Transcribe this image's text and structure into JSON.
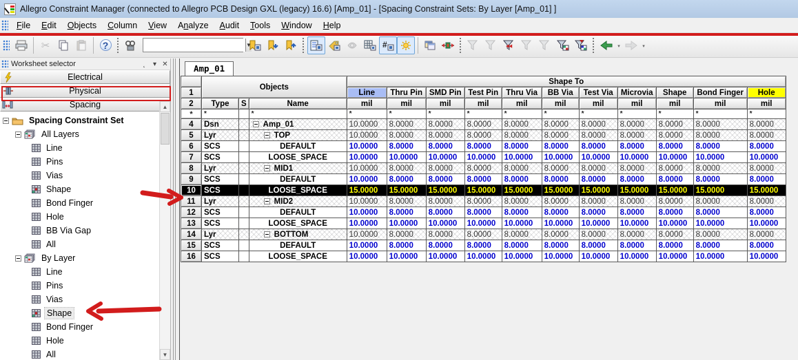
{
  "window": {
    "title": "Allegro Constraint Manager (connected to Allegro PCB Design GXL (legacy) 16.6) [Amp_01] - [Spacing Constraint Sets:  By Layer [Amp_01] ]"
  },
  "menu": {
    "items": [
      {
        "label": "File",
        "underline": 0
      },
      {
        "label": "Edit",
        "underline": 0
      },
      {
        "label": "Objects",
        "underline": 0
      },
      {
        "label": "Column",
        "underline": 0
      },
      {
        "label": "View",
        "underline": 0
      },
      {
        "label": "Analyze",
        "underline": 1
      },
      {
        "label": "Audit",
        "underline": 0
      },
      {
        "label": "Tools",
        "underline": 0
      },
      {
        "label": "Window",
        "underline": 0
      },
      {
        "label": "Help",
        "underline": 0
      }
    ]
  },
  "toolbar": {
    "search": {
      "value": "",
      "placeholder": ""
    },
    "buttons": [
      {
        "name": "print-icon",
        "disabled": false,
        "active": false
      },
      {
        "name": "cut-icon",
        "disabled": true,
        "active": false
      },
      {
        "name": "copy-icon",
        "disabled": false,
        "active": false
      },
      {
        "name": "paste-icon",
        "disabled": true,
        "active": false
      },
      {
        "name": "help-icon",
        "disabled": false,
        "active": false
      },
      {
        "name": "find-icon",
        "disabled": false,
        "active": false
      },
      {
        "name": "bookmark-add-icon",
        "disabled": false,
        "active": false
      },
      {
        "name": "bookmark-down-icon",
        "disabled": false,
        "active": false
      },
      {
        "name": "bookmark-up-icon",
        "disabled": false,
        "active": false
      },
      {
        "name": "worksheet-selector-icon",
        "disabled": false,
        "active": true
      },
      {
        "name": "tag-icon",
        "disabled": false,
        "active": false
      },
      {
        "name": "hierarchy-icon",
        "disabled": true,
        "active": false
      },
      {
        "name": "table-view-icon",
        "disabled": false,
        "active": false
      },
      {
        "name": "show-values-icon",
        "disabled": false,
        "active": true
      },
      {
        "name": "highlight-icon",
        "disabled": false,
        "active": true
      },
      {
        "name": "copy-window-icon",
        "disabled": false,
        "active": false
      },
      {
        "name": "cross-probe-icon",
        "disabled": false,
        "active": false
      },
      {
        "name": "filter-refresh-icon",
        "disabled": true,
        "active": false
      },
      {
        "name": "filter-off-icon",
        "disabled": true,
        "active": false
      },
      {
        "name": "filter-bowtie-icon",
        "disabled": false,
        "active": false
      },
      {
        "name": "filter-sort-icon",
        "disabled": true,
        "active": false
      },
      {
        "name": "filter-hatch-icon",
        "disabled": true,
        "active": false
      },
      {
        "name": "filter-table-icon",
        "disabled": false,
        "active": false
      },
      {
        "name": "filter-color-icon",
        "disabled": false,
        "active": false
      },
      {
        "name": "back-icon",
        "disabled": false,
        "active": false
      },
      {
        "name": "forward-icon",
        "disabled": true,
        "active": false
      }
    ]
  },
  "sidebar": {
    "header": {
      "title": "Worksheet selector"
    },
    "selectors": [
      {
        "label": "Electrical",
        "icon": "lightning-icon",
        "annotated": false
      },
      {
        "label": "Physical",
        "icon": "physical-icon",
        "annotated": false
      },
      {
        "label": "Spacing",
        "icon": "spacing-icon",
        "annotated": true
      }
    ],
    "tree": {
      "root": {
        "label": "Spacing Constraint Set",
        "icon": "folder-icon"
      },
      "groups": [
        {
          "label": "All Layers",
          "icon": "layers-icon",
          "items": [
            {
              "label": "Line",
              "icon": "grid-icon",
              "selected": false
            },
            {
              "label": "Pins",
              "icon": "grid-icon",
              "selected": false
            },
            {
              "label": "Vias",
              "icon": "grid-icon",
              "selected": false
            },
            {
              "label": "Shape",
              "icon": "grid-red-icon",
              "selected": false
            },
            {
              "label": "Bond Finger",
              "icon": "grid-icon",
              "selected": false
            },
            {
              "label": "Hole",
              "icon": "grid-icon",
              "selected": false
            },
            {
              "label": "BB Via Gap",
              "icon": "grid-icon",
              "selected": false
            },
            {
              "label": "All",
              "icon": "grid-icon",
              "selected": false
            }
          ]
        },
        {
          "label": "By Layer",
          "icon": "layers-icon",
          "items": [
            {
              "label": "Line",
              "icon": "grid-icon",
              "selected": false
            },
            {
              "label": "Pins",
              "icon": "grid-icon",
              "selected": false
            },
            {
              "label": "Vias",
              "icon": "grid-icon",
              "selected": false
            },
            {
              "label": "Shape",
              "icon": "grid-red-icon",
              "selected": true
            },
            {
              "label": "Bond Finger",
              "icon": "grid-icon",
              "selected": false
            },
            {
              "label": "Hole",
              "icon": "grid-icon",
              "selected": false
            },
            {
              "label": "All",
              "icon": "grid-icon",
              "selected": false
            }
          ]
        }
      ]
    }
  },
  "main": {
    "tab": "Amp_01",
    "table": {
      "objects_header": "Objects",
      "shape_to_header": "Shape To",
      "row1_label": "1",
      "row2_label": "2",
      "filter_label": "*",
      "type_header": "Type",
      "s_header": "S",
      "name_header": "Name",
      "unit": "mil",
      "columns": [
        {
          "label": "Line",
          "highlight": "blue"
        },
        {
          "label": "Thru Pin",
          "highlight": ""
        },
        {
          "label": "SMD Pin",
          "highlight": ""
        },
        {
          "label": "Test Pin",
          "highlight": ""
        },
        {
          "label": "Thru Via",
          "highlight": ""
        },
        {
          "label": "BB Via",
          "highlight": ""
        },
        {
          "label": "Test Via",
          "highlight": ""
        },
        {
          "label": "Microvia",
          "highlight": ""
        },
        {
          "label": "Shape",
          "highlight": ""
        },
        {
          "label": "Bond Finger",
          "highlight": ""
        },
        {
          "label": "Hole",
          "highlight": "yellow"
        }
      ],
      "filter_row": {
        "num": "*",
        "type": "*",
        "s": "",
        "name": "*",
        "values": [
          "*",
          "*",
          "*",
          "*",
          "*",
          "*",
          "*",
          "*",
          "*",
          "*",
          "*"
        ]
      },
      "rows": [
        {
          "num": "4",
          "type": "Dsn",
          "s": "",
          "name": "Amp_01",
          "level": 0,
          "expander": true,
          "style": "hatch",
          "values": [
            "10.0000",
            "8.0000",
            "8.0000",
            "8.0000",
            "8.0000",
            "8.0000",
            "8.0000",
            "8.0000",
            "8.0000",
            "8.0000",
            "8.0000"
          ]
        },
        {
          "num": "5",
          "type": "Lyr",
          "s": "",
          "name": "TOP",
          "level": 1,
          "expander": true,
          "style": "hatch",
          "values": [
            "10.0000",
            "8.0000",
            "8.0000",
            "8.0000",
            "8.0000",
            "8.0000",
            "8.0000",
            "8.0000",
            "8.0000",
            "8.0000",
            "8.0000"
          ]
        },
        {
          "num": "6",
          "type": "SCS",
          "s": "",
          "name": "DEFAULT",
          "level": 2,
          "expander": false,
          "style": "scs",
          "values": [
            "10.0000",
            "8.0000",
            "8.0000",
            "8.0000",
            "8.0000",
            "8.0000",
            "8.0000",
            "8.0000",
            "8.0000",
            "8.0000",
            "8.0000"
          ]
        },
        {
          "num": "7",
          "type": "SCS",
          "s": "",
          "name": "LOOSE_SPACE",
          "level": 2,
          "expander": false,
          "style": "scs",
          "values": [
            "10.0000",
            "10.0000",
            "10.0000",
            "10.0000",
            "10.0000",
            "10.0000",
            "10.0000",
            "10.0000",
            "10.0000",
            "10.0000",
            "10.0000"
          ]
        },
        {
          "num": "8",
          "type": "Lyr",
          "s": "",
          "name": "MID1",
          "level": 1,
          "expander": true,
          "style": "hatch",
          "values": [
            "10.0000",
            "8.0000",
            "8.0000",
            "8.0000",
            "8.0000",
            "8.0000",
            "8.0000",
            "8.0000",
            "8.0000",
            "8.0000",
            "8.0000"
          ]
        },
        {
          "num": "9",
          "type": "SCS",
          "s": "",
          "name": "DEFAULT",
          "level": 2,
          "expander": false,
          "style": "scs",
          "values": [
            "10.0000",
            "8.0000",
            "8.0000",
            "8.0000",
            "8.0000",
            "8.0000",
            "8.0000",
            "8.0000",
            "8.0000",
            "8.0000",
            "8.0000"
          ]
        },
        {
          "num": "10",
          "type": "SCS",
          "s": "",
          "name": "LOOSE_SPACE",
          "level": 2,
          "expander": false,
          "style": "sel",
          "values": [
            "15.0000",
            "15.0000",
            "15.0000",
            "15.0000",
            "15.0000",
            "15.0000",
            "15.0000",
            "15.0000",
            "15.0000",
            "15.0000",
            "15.0000"
          ]
        },
        {
          "num": "11",
          "type": "Lyr",
          "s": "",
          "name": "MID2",
          "level": 1,
          "expander": true,
          "style": "hatch",
          "values": [
            "10.0000",
            "8.0000",
            "8.0000",
            "8.0000",
            "8.0000",
            "8.0000",
            "8.0000",
            "8.0000",
            "8.0000",
            "8.0000",
            "8.0000"
          ]
        },
        {
          "num": "12",
          "type": "SCS",
          "s": "",
          "name": "DEFAULT",
          "level": 2,
          "expander": false,
          "style": "scs",
          "values": [
            "10.0000",
            "8.0000",
            "8.0000",
            "8.0000",
            "8.0000",
            "8.0000",
            "8.0000",
            "8.0000",
            "8.0000",
            "8.0000",
            "8.0000"
          ]
        },
        {
          "num": "13",
          "type": "SCS",
          "s": "",
          "name": "LOOSE_SPACE",
          "level": 2,
          "expander": false,
          "style": "scs",
          "values": [
            "10.0000",
            "10.0000",
            "10.0000",
            "10.0000",
            "10.0000",
            "10.0000",
            "10.0000",
            "10.0000",
            "10.0000",
            "10.0000",
            "10.0000"
          ]
        },
        {
          "num": "14",
          "type": "Lyr",
          "s": "",
          "name": "BOTTOM",
          "level": 1,
          "expander": true,
          "style": "hatch",
          "values": [
            "10.0000",
            "8.0000",
            "8.0000",
            "8.0000",
            "8.0000",
            "8.0000",
            "8.0000",
            "8.0000",
            "8.0000",
            "8.0000",
            "8.0000"
          ]
        },
        {
          "num": "15",
          "type": "SCS",
          "s": "",
          "name": "DEFAULT",
          "level": 2,
          "expander": false,
          "style": "scs",
          "values": [
            "10.0000",
            "8.0000",
            "8.0000",
            "8.0000",
            "8.0000",
            "8.0000",
            "8.0000",
            "8.0000",
            "8.0000",
            "8.0000",
            "8.0000"
          ]
        },
        {
          "num": "16",
          "type": "SCS",
          "s": "",
          "name": "LOOSE_SPACE",
          "level": 2,
          "expander": false,
          "style": "scs",
          "values": [
            "10.0000",
            "10.0000",
            "10.0000",
            "10.0000",
            "10.0000",
            "10.0000",
            "10.0000",
            "10.0000",
            "10.0000",
            "10.0000",
            "10.0000"
          ]
        }
      ]
    }
  },
  "annotations": {
    "color": "#d21c1c",
    "items": [
      "underline-below-menubar",
      "box-around-spacing-button",
      "arrow-to-row-10",
      "arrow-to-tree-shape"
    ]
  },
  "colors": {
    "titlebar": "#b9cde8",
    "selected_row_bg": "#000000",
    "selected_row_value": "#ffff00",
    "scs_value": "#0000cd",
    "line_col_header": "#a9bdf5",
    "hole_col_header": "#ffff00"
  }
}
